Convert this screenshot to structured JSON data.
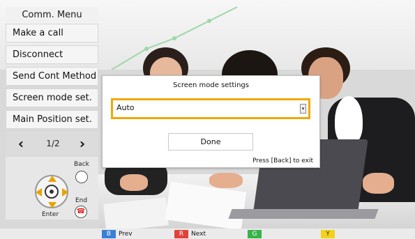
{
  "menu": {
    "title": "Comm. Menu",
    "items": [
      {
        "label": "Make a call"
      },
      {
        "label": "Disconnect"
      },
      {
        "label": "Send Cont Method"
      },
      {
        "label": "Screen mode set."
      },
      {
        "label": "Main Position set."
      }
    ],
    "pager": {
      "prev_icon": "chevron-left-icon",
      "page": "1/2",
      "next_icon": "chevron-right-icon"
    }
  },
  "remote": {
    "back_label": "Back",
    "end_label": "End",
    "enter_label": "Enter"
  },
  "dialog": {
    "title": "Screen mode settings",
    "select_value": "Auto",
    "done_label": "Done",
    "hint": "Press [Back] to exit",
    "accent": "#f0a800"
  },
  "keys": {
    "blue": {
      "chip": "B",
      "label": "Prev",
      "color": "#3a7fd5"
    },
    "red": {
      "chip": "R",
      "label": "Next",
      "color": "#e0413a"
    },
    "green": {
      "chip": "G",
      "label": "",
      "color": "#38b34a"
    },
    "yellow": {
      "chip": "Y",
      "label": "",
      "color": "#f2d21b"
    }
  }
}
